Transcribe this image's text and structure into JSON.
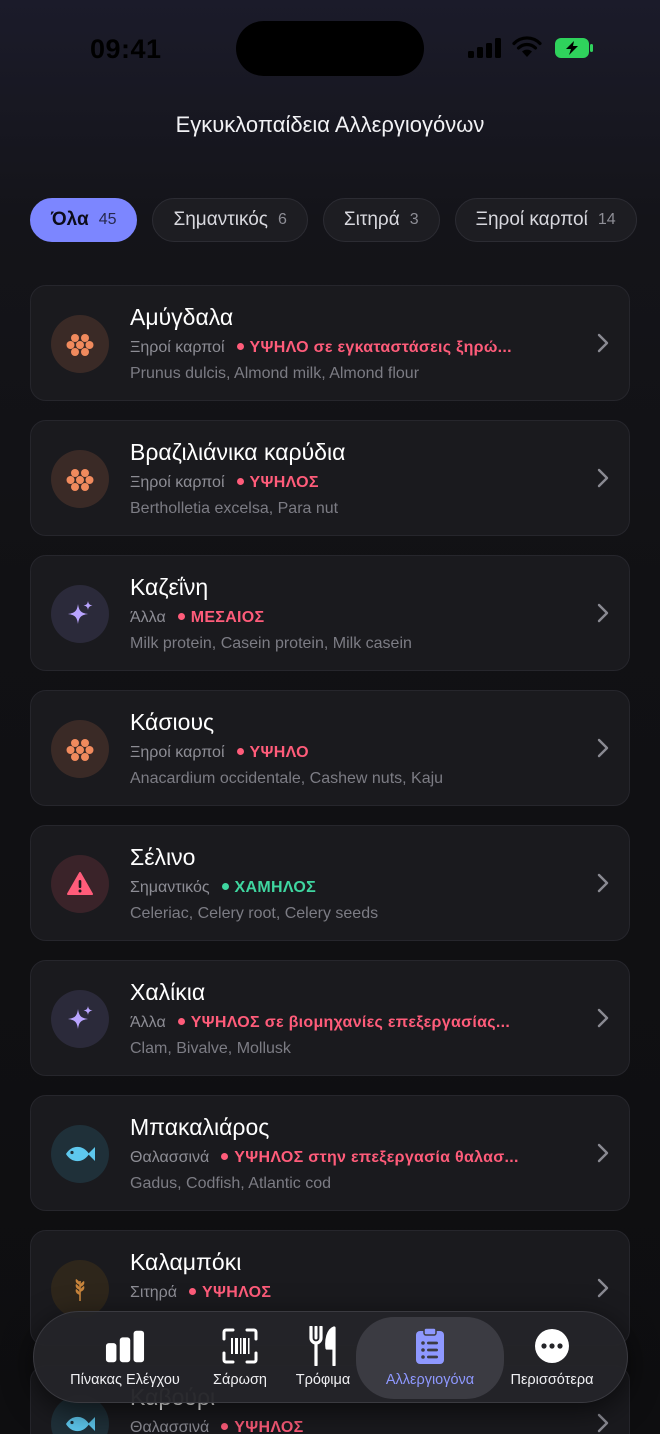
{
  "status_bar": {
    "time": "09:41"
  },
  "header": {
    "title": "Εγκυκλοπαίδεια Αλλεργιογόνων"
  },
  "filters": [
    {
      "label": "Όλα",
      "count": "45",
      "active": true
    },
    {
      "label": "Σημαντικός",
      "count": "6",
      "active": false
    },
    {
      "label": "Σιτηρά",
      "count": "3",
      "active": false
    },
    {
      "label": "Ξηροί καρποί",
      "count": "14",
      "active": false
    }
  ],
  "allergens": [
    {
      "name": "Αμύγδαλα",
      "category": "Ξηροί καρποί",
      "risk": "ΥΨΗΛΟ σε εγκαταστάσεις ξηρώ...",
      "risk_color": "#ff5c7a",
      "aliases": "Prunus dulcis, Almond milk, Almond flour",
      "icon": "nut-cluster-icon",
      "icon_color": "#f08a5d",
      "icon_bg": "#3a2a26"
    },
    {
      "name": "Βραζιλιάνικα καρύδια",
      "category": "Ξηροί καρποί",
      "risk": "ΥΨΗΛΟΣ",
      "risk_color": "#ff5c7a",
      "aliases": "Bertholletia excelsa, Para nut",
      "icon": "nut-cluster-icon",
      "icon_color": "#f08a5d",
      "icon_bg": "#3a2a26"
    },
    {
      "name": "Καζεΐνη",
      "category": "Άλλα",
      "risk": "ΜΕΣΑΙΟΣ",
      "risk_color": "#ff5c7a",
      "aliases": "Milk protein, Casein protein, Milk casein",
      "icon": "sparkles-icon",
      "icon_color": "#b9a4ff",
      "icon_bg": "#2b2a3a"
    },
    {
      "name": "Κάσιους",
      "category": "Ξηροί καρποί",
      "risk": "ΥΨΗΛΟ",
      "risk_color": "#ff5c7a",
      "aliases": "Anacardium occidentale, Cashew nuts, Kaju",
      "icon": "nut-cluster-icon",
      "icon_color": "#f08a5d",
      "icon_bg": "#3a2a26"
    },
    {
      "name": "Σέλινο",
      "category": "Σημαντικός",
      "risk": "ΧΑΜΗΛΟΣ",
      "risk_color": "#3fd6a0",
      "aliases": "Celeriac, Celery root, Celery seeds",
      "icon": "warning-triangle-icon",
      "icon_color": "#ff5c7a",
      "icon_bg": "#3a2329"
    },
    {
      "name": "Χαλίκια",
      "category": "Άλλα",
      "risk": "ΥΨΗΛΟΣ σε βιομηχανίες επεξεργασίας...",
      "risk_color": "#ff5c7a",
      "aliases": "Clam, Bivalve, Mollusk",
      "icon": "sparkles-icon",
      "icon_color": "#b9a4ff",
      "icon_bg": "#2b2a3a"
    },
    {
      "name": "Μπακαλιάρος",
      "category": "Θαλασσινά",
      "risk": "ΥΨΗΛΟΣ στην επεξεργασία θαλασ...",
      "risk_color": "#ff5c7a",
      "aliases": "Gadus, Codfish, Atlantic cod",
      "icon": "fish-icon",
      "icon_color": "#5ec8ee",
      "icon_bg": "#1f3039"
    },
    {
      "name": "Καλαμπόκι",
      "category": "Σιτηρά",
      "risk": "ΥΨΗΛΟΣ",
      "risk_color": "#ff5c7a",
      "aliases": "",
      "icon": "wheat-icon",
      "icon_color": "#c9853c",
      "icon_bg": "#2e261b"
    },
    {
      "name": "Καβούρι",
      "category": "Θαλασσινά",
      "risk": "ΥΨΗΛΟΣ",
      "risk_color": "#ff5c7a",
      "aliases": "",
      "icon": "fish-icon",
      "icon_color": "#5ec8ee",
      "icon_bg": "#1f3039"
    }
  ],
  "tabbar": {
    "items": [
      {
        "label": "Πίνακας Ελέγχου",
        "icon": "bar-chart-icon"
      },
      {
        "label": "Σάρωση",
        "icon": "barcode-scan-icon"
      },
      {
        "label": "Τρόφιμα",
        "icon": "fork-knife-icon"
      },
      {
        "label": "Αλλεργιογόνα",
        "icon": "clipboard-list-icon",
        "active": true
      },
      {
        "label": "Περισσότερα",
        "icon": "more-ellipsis-icon"
      }
    ]
  }
}
